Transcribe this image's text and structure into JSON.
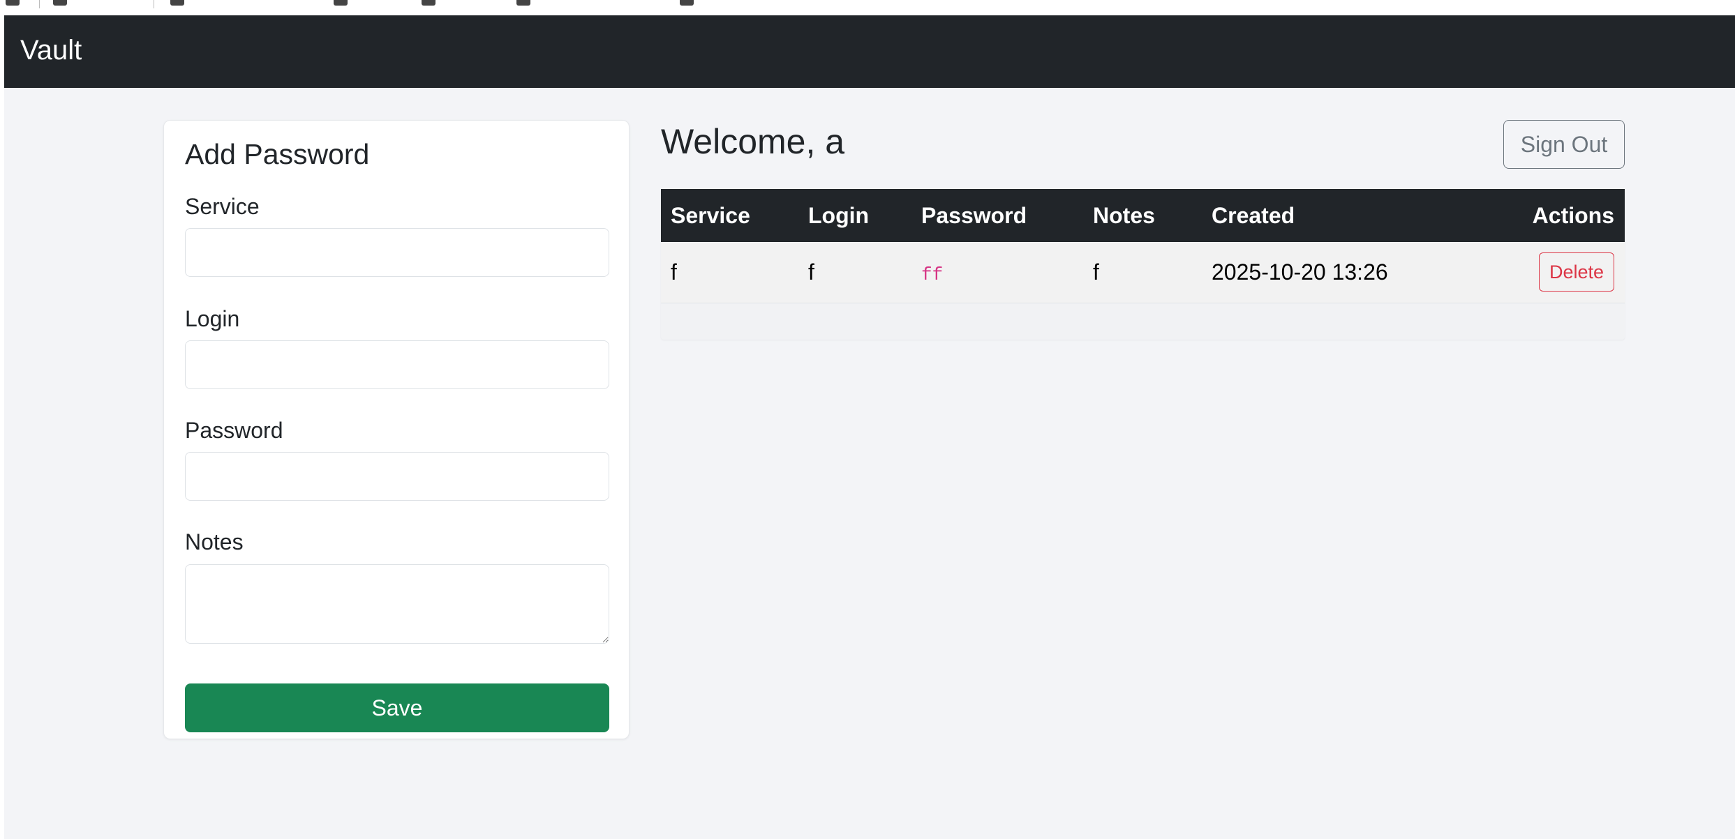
{
  "navbar": {
    "brand": "Vault"
  },
  "add_form": {
    "title": "Add Password",
    "service_label": "Service",
    "service_value": "",
    "login_label": "Login",
    "login_value": "",
    "password_label": "Password",
    "password_value": "",
    "notes_label": "Notes",
    "notes_value": "",
    "save_label": "Save"
  },
  "header": {
    "welcome": "Welcome, a",
    "signout_label": "Sign Out"
  },
  "table": {
    "columns": [
      "Service",
      "Login",
      "Password",
      "Notes",
      "Created",
      "Actions"
    ],
    "rows": [
      {
        "service": "f",
        "login": "f",
        "password": "ff",
        "notes": "f",
        "created": "2025-10-20 13:26",
        "action_label": "Delete"
      }
    ]
  },
  "colors": {
    "navbar_bg": "#212529",
    "page_bg": "#f3f4f7",
    "save_green": "#198754",
    "delete_red": "#dc3545",
    "code_pink": "#d63384",
    "signout_gray": "#6c757d"
  }
}
